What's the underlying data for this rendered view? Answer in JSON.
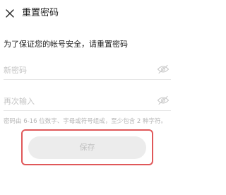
{
  "header": {
    "close_icon": "close-icon",
    "title": "重置密码"
  },
  "subtitle": "为了保证您的帐号安全，请重置密码",
  "form": {
    "new_password": {
      "value": "",
      "placeholder": "新密码",
      "toggle_icon": "eye-off-icon"
    },
    "confirm_password": {
      "value": "",
      "placeholder": "再次输入",
      "toggle_icon": "eye-off-icon"
    },
    "hint": "密码由 6-16 位数字、字母或符号组成，至少包含 2 种字符。"
  },
  "actions": {
    "save_label": "保存",
    "save_enabled": false
  },
  "colors": {
    "highlight_border": "#e0585a",
    "button_bg_disabled": "#ececec",
    "button_text_disabled": "#c2c2c2",
    "placeholder": "#c4c4c4"
  }
}
